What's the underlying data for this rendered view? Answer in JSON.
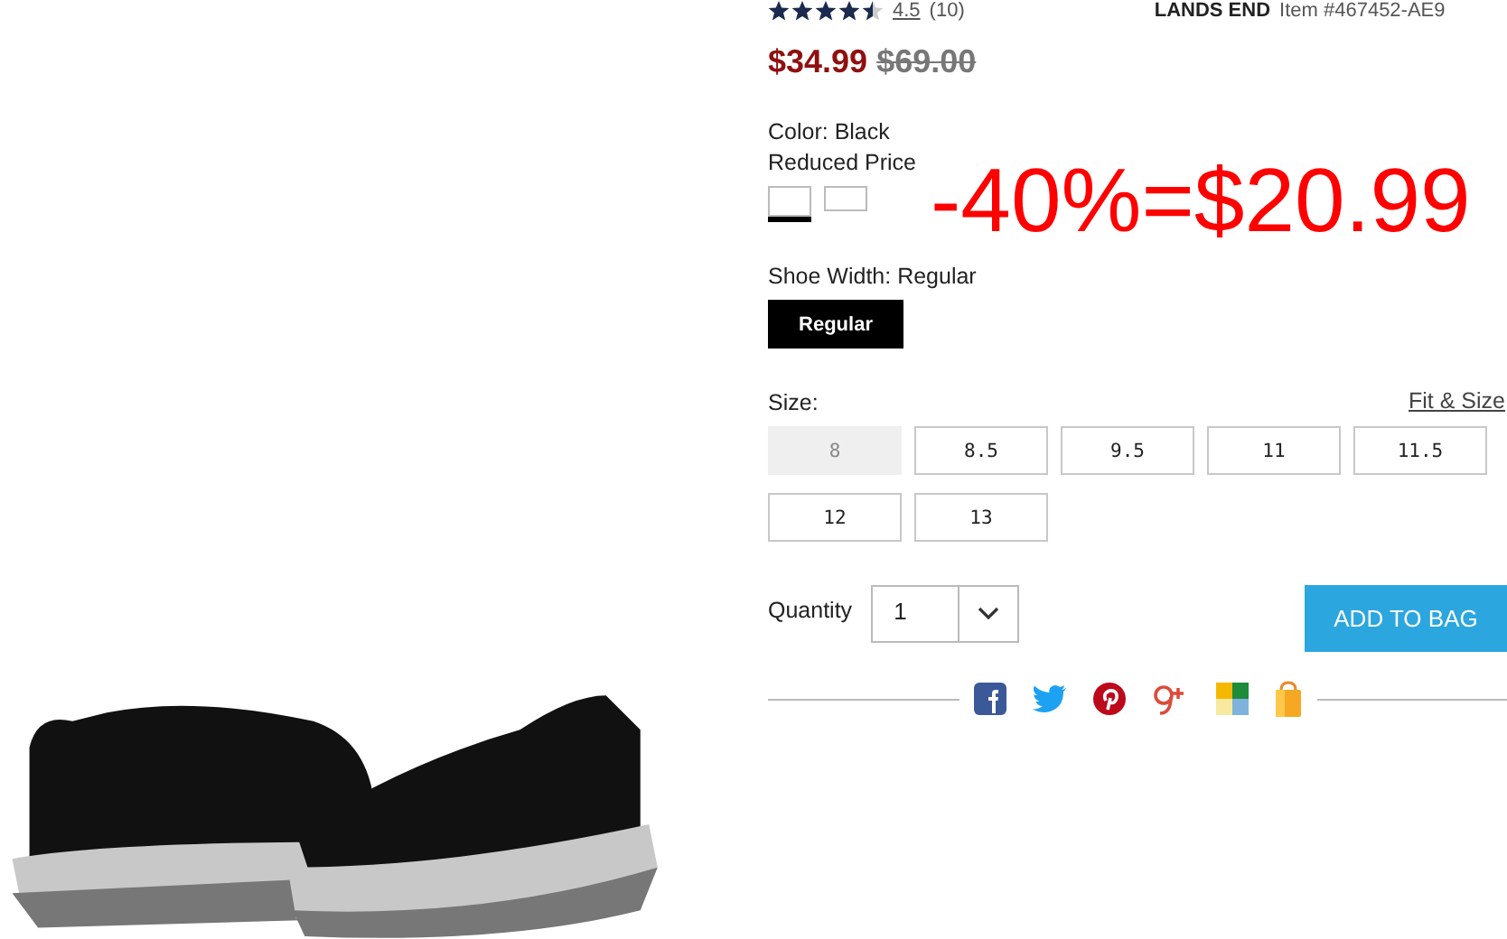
{
  "rating": {
    "stars": 4.5,
    "score": "4.5",
    "count": "(10)"
  },
  "brand": "LANDS END",
  "item_number": "Item #467452-AE9",
  "price": {
    "sale": "$34.99",
    "original": "$69.00"
  },
  "color": {
    "label": "Color: Black",
    "note": "Reduced Price",
    "swatches": [
      {
        "selected": true
      },
      {
        "selected": false
      }
    ]
  },
  "annotation": "-40%=$20.99",
  "width": {
    "label": "Shoe Width: Regular",
    "options": [
      {
        "label": "Regular",
        "selected": true
      }
    ]
  },
  "size": {
    "label": "Size:",
    "fit_link": "Fit & Size",
    "options": [
      {
        "label": "8",
        "disabled": true
      },
      {
        "label": "8.5",
        "disabled": false
      },
      {
        "label": "9.5",
        "disabled": false
      },
      {
        "label": "11",
        "disabled": false
      },
      {
        "label": "11.5",
        "disabled": false
      },
      {
        "label": "12",
        "disabled": false
      },
      {
        "label": "13",
        "disabled": false
      }
    ]
  },
  "quantity": {
    "label": "Quantity",
    "value": "1"
  },
  "add_button": "ADD TO BAG"
}
